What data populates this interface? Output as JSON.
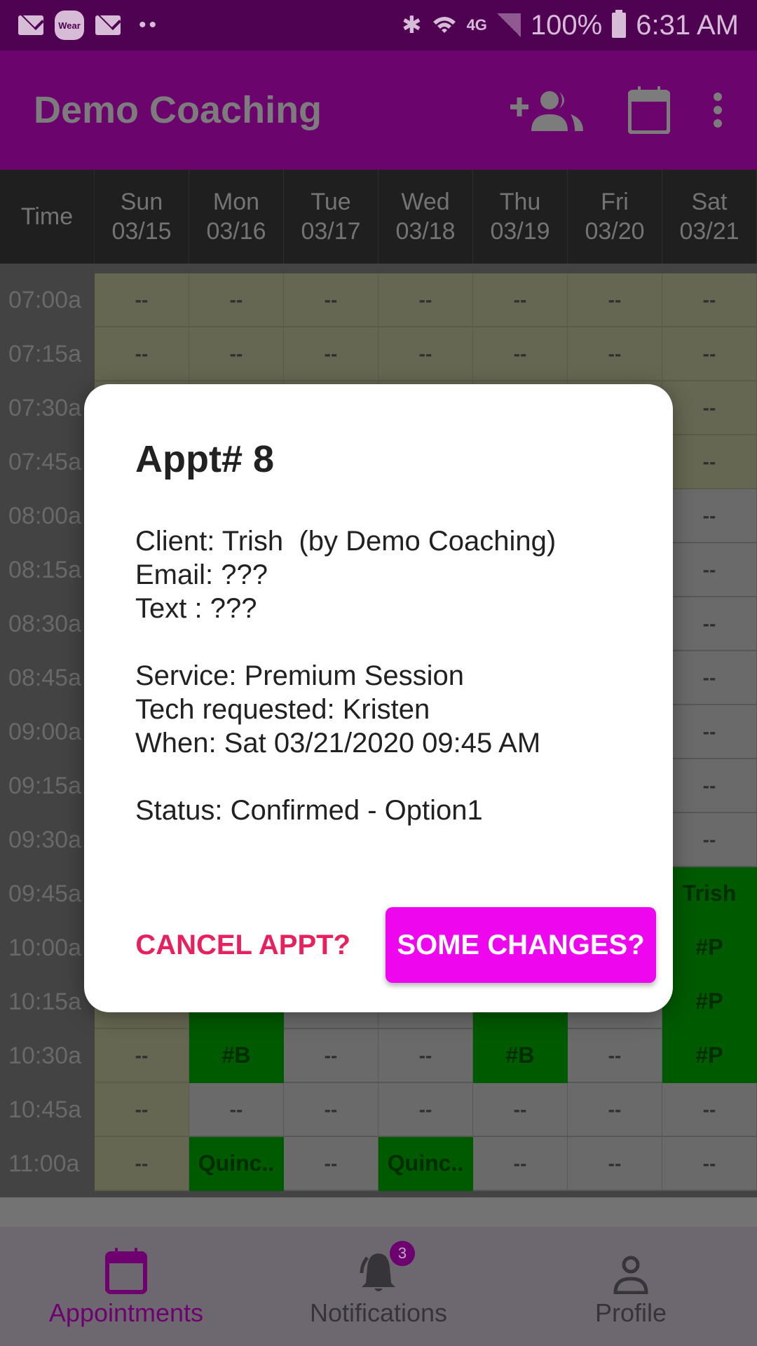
{
  "status_bar": {
    "notifications": [
      "mail-icon",
      "wear-icon",
      "mail-icon",
      "more-dots-icon"
    ],
    "wear_label": "Wear",
    "dots": "••",
    "network": "4G",
    "battery": "100%",
    "time": "6:31 AM"
  },
  "app_bar": {
    "title": "Demo Coaching",
    "actions": [
      "add-client-icon",
      "calendar-icon",
      "overflow-menu-icon"
    ]
  },
  "schedule": {
    "time_header": "Time",
    "days": [
      {
        "day": "Sun",
        "date": "03/15"
      },
      {
        "day": "Mon",
        "date": "03/16"
      },
      {
        "day": "Tue",
        "date": "03/17"
      },
      {
        "day": "Wed",
        "date": "03/18"
      },
      {
        "day": "Thu",
        "date": "03/19"
      },
      {
        "day": "Fri",
        "date": "03/20"
      },
      {
        "day": "Sat",
        "date": "03/21"
      }
    ],
    "rows": [
      {
        "time": "07:00a",
        "cells": [
          {
            "t": "--",
            "s": "closed"
          },
          {
            "t": "--",
            "s": "closed"
          },
          {
            "t": "--",
            "s": "closed"
          },
          {
            "t": "--",
            "s": "closed"
          },
          {
            "t": "--",
            "s": "closed"
          },
          {
            "t": "--",
            "s": "closed"
          },
          {
            "t": "--",
            "s": "closed"
          }
        ]
      },
      {
        "time": "07:15a",
        "cells": [
          {
            "t": "--",
            "s": "closed"
          },
          {
            "t": "--",
            "s": "closed"
          },
          {
            "t": "--",
            "s": "closed"
          },
          {
            "t": "--",
            "s": "closed"
          },
          {
            "t": "--",
            "s": "closed"
          },
          {
            "t": "--",
            "s": "closed"
          },
          {
            "t": "--",
            "s": "closed"
          }
        ]
      },
      {
        "time": "07:30a",
        "cells": [
          {
            "t": "--",
            "s": "closed"
          },
          {
            "t": "--",
            "s": "closed"
          },
          {
            "t": "--",
            "s": "closed"
          },
          {
            "t": "--",
            "s": "closed"
          },
          {
            "t": "--",
            "s": "closed"
          },
          {
            "t": "--",
            "s": "closed"
          },
          {
            "t": "--",
            "s": "closed"
          }
        ]
      },
      {
        "time": "07:45a",
        "cells": [
          {
            "t": "--",
            "s": "closed"
          },
          {
            "t": "--",
            "s": "closed"
          },
          {
            "t": "--",
            "s": "closed"
          },
          {
            "t": "--",
            "s": "closed"
          },
          {
            "t": "--",
            "s": "closed"
          },
          {
            "t": "--",
            "s": "closed"
          },
          {
            "t": "--",
            "s": "closed"
          }
        ]
      },
      {
        "time": "08:00a",
        "cells": [
          {
            "t": "--",
            "s": "closed"
          },
          {
            "t": "--",
            "s": "open"
          },
          {
            "t": "--",
            "s": "open"
          },
          {
            "t": "--",
            "s": "open"
          },
          {
            "t": "--",
            "s": "open"
          },
          {
            "t": "--",
            "s": "open"
          },
          {
            "t": "--",
            "s": "open"
          }
        ]
      },
      {
        "time": "08:15a",
        "cells": [
          {
            "t": "--",
            "s": "closed"
          },
          {
            "t": "--",
            "s": "open"
          },
          {
            "t": "--",
            "s": "open"
          },
          {
            "t": "--",
            "s": "open"
          },
          {
            "t": "--",
            "s": "open"
          },
          {
            "t": "--",
            "s": "open"
          },
          {
            "t": "--",
            "s": "open"
          }
        ]
      },
      {
        "time": "08:30a",
        "cells": [
          {
            "t": "--",
            "s": "closed"
          },
          {
            "t": "--",
            "s": "open"
          },
          {
            "t": "--",
            "s": "open"
          },
          {
            "t": "--",
            "s": "open"
          },
          {
            "t": "--",
            "s": "open"
          },
          {
            "t": "--",
            "s": "open"
          },
          {
            "t": "--",
            "s": "open"
          }
        ]
      },
      {
        "time": "08:45a",
        "cells": [
          {
            "t": "--",
            "s": "closed"
          },
          {
            "t": "--",
            "s": "open"
          },
          {
            "t": "--",
            "s": "open"
          },
          {
            "t": "--",
            "s": "open"
          },
          {
            "t": "--",
            "s": "open"
          },
          {
            "t": "--",
            "s": "open"
          },
          {
            "t": "--",
            "s": "open"
          }
        ]
      },
      {
        "time": "09:00a",
        "cells": [
          {
            "t": "--",
            "s": "closed"
          },
          {
            "t": "--",
            "s": "open"
          },
          {
            "t": "--",
            "s": "open"
          },
          {
            "t": "--",
            "s": "open"
          },
          {
            "t": "--",
            "s": "open"
          },
          {
            "t": "--",
            "s": "open"
          },
          {
            "t": "--",
            "s": "open"
          }
        ]
      },
      {
        "time": "09:15a",
        "cells": [
          {
            "t": "--",
            "s": "closed"
          },
          {
            "t": "--",
            "s": "open"
          },
          {
            "t": "--",
            "s": "open"
          },
          {
            "t": "--",
            "s": "open"
          },
          {
            "t": "--",
            "s": "open"
          },
          {
            "t": "--",
            "s": "open"
          },
          {
            "t": "--",
            "s": "open"
          }
        ]
      },
      {
        "time": "09:30a",
        "cells": [
          {
            "t": "--",
            "s": "closed"
          },
          {
            "t": "--",
            "s": "open"
          },
          {
            "t": "--",
            "s": "open"
          },
          {
            "t": "--",
            "s": "open"
          },
          {
            "t": "--",
            "s": "open"
          },
          {
            "t": "--",
            "s": "open"
          },
          {
            "t": "--",
            "s": "open"
          }
        ]
      },
      {
        "time": "09:45a",
        "cells": [
          {
            "t": "--",
            "s": "closed"
          },
          {
            "t": "--",
            "s": "open"
          },
          {
            "t": "--",
            "s": "open"
          },
          {
            "t": "--",
            "s": "open"
          },
          {
            "t": "--",
            "s": "open"
          },
          {
            "t": "--",
            "s": "open"
          },
          {
            "t": "Trish",
            "s": "booked"
          }
        ]
      },
      {
        "time": "10:00a",
        "cells": [
          {
            "t": "--",
            "s": "closed"
          },
          {
            "t": "--",
            "s": "open"
          },
          {
            "t": "--",
            "s": "open"
          },
          {
            "t": "--",
            "s": "open"
          },
          {
            "t": "--",
            "s": "open"
          },
          {
            "t": "--",
            "s": "open"
          },
          {
            "t": "#P",
            "s": "booked"
          }
        ]
      },
      {
        "time": "10:15a",
        "cells": [
          {
            "t": "--",
            "s": "closed"
          },
          {
            "t": "",
            "s": "booked"
          },
          {
            "t": "--",
            "s": "open"
          },
          {
            "t": "--",
            "s": "open"
          },
          {
            "t": "",
            "s": "booked"
          },
          {
            "t": "--",
            "s": "open"
          },
          {
            "t": "#P",
            "s": "booked"
          }
        ]
      },
      {
        "time": "10:30a",
        "cells": [
          {
            "t": "--",
            "s": "closed"
          },
          {
            "t": "#B",
            "s": "booked"
          },
          {
            "t": "--",
            "s": "open"
          },
          {
            "t": "--",
            "s": "open"
          },
          {
            "t": "#B",
            "s": "booked"
          },
          {
            "t": "--",
            "s": "open"
          },
          {
            "t": "#P",
            "s": "booked"
          }
        ]
      },
      {
        "time": "10:45a",
        "cells": [
          {
            "t": "--",
            "s": "closed"
          },
          {
            "t": "--",
            "s": "open"
          },
          {
            "t": "--",
            "s": "open"
          },
          {
            "t": "--",
            "s": "open"
          },
          {
            "t": "--",
            "s": "open"
          },
          {
            "t": "--",
            "s": "open"
          },
          {
            "t": "--",
            "s": "open"
          }
        ]
      },
      {
        "time": "11:00a",
        "cells": [
          {
            "t": "--",
            "s": "closed"
          },
          {
            "t": "Quinc..",
            "s": "booked"
          },
          {
            "t": "--",
            "s": "open"
          },
          {
            "t": "Quinc..",
            "s": "booked"
          },
          {
            "t": "--",
            "s": "open"
          },
          {
            "t": "--",
            "s": "open"
          },
          {
            "t": "--",
            "s": "open"
          }
        ]
      }
    ]
  },
  "dialog": {
    "title": "Appt# 8",
    "client": "Client: Trish  (by Demo Coaching)",
    "email": "Email: ???",
    "text": "Text : ???",
    "service": "Service: Premium Session",
    "tech": "Tech requested: Kristen",
    "when": "When: Sat 03/21/2020 09:45 AM",
    "status": "Status: Confirmed - Option1",
    "cancel_label": "CANCEL APPT?",
    "changes_label": "SOME CHANGES?"
  },
  "bottom_nav": {
    "items": [
      {
        "label": "Appointments",
        "icon": "calendar-icon",
        "active": true
      },
      {
        "label": "Notifications",
        "icon": "bell-icon",
        "badge": "3"
      },
      {
        "label": "Profile",
        "icon": "person-icon"
      }
    ]
  },
  "colors": {
    "status_bar": "#4f0152",
    "app_bar": "#6b046c",
    "accent_pink": "#ee06ee",
    "cancel_text": "#e8215e",
    "booked_green": "#016201",
    "nav_active": "#6f006f"
  }
}
